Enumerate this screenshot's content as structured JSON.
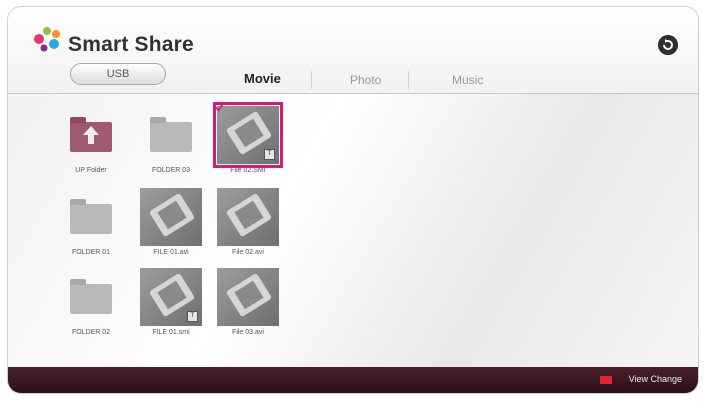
{
  "app": {
    "title": "Smart Share"
  },
  "header": {
    "device_button": "USB",
    "tabs": [
      {
        "label": "Movie",
        "active": true
      },
      {
        "label": "Photo",
        "active": false
      },
      {
        "label": "Music",
        "active": false
      }
    ],
    "back_icon": "return-arrow-icon"
  },
  "items": [
    {
      "type": "up-folder",
      "label": "UP Folder"
    },
    {
      "type": "folder",
      "label": "FOLDER 03"
    },
    {
      "type": "movie",
      "label": "File 02.SMI",
      "selected": true,
      "subtitle_badge": "T"
    },
    {
      "type": "folder",
      "label": "FOLDER 01"
    },
    {
      "type": "movie",
      "label": "FILE 01.avi"
    },
    {
      "type": "movie",
      "label": "File 02.avi"
    },
    {
      "type": "folder",
      "label": "FOLDER 02"
    },
    {
      "type": "movie",
      "label": "FILE 01.smi",
      "subtitle_badge": "T"
    },
    {
      "type": "movie",
      "label": "File 03.avi"
    }
  ],
  "footer": {
    "hint_key_color": "#e0262e",
    "hint_label": "View Change"
  },
  "colors": {
    "selection": "#d61b73",
    "footer_bg": "#3b1520"
  }
}
